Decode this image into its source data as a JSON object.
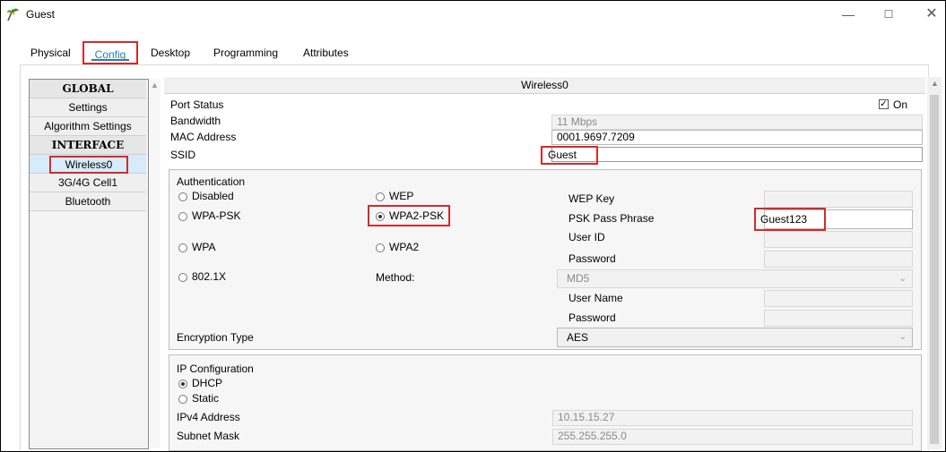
{
  "window": {
    "title": "Guest",
    "minimize": "—",
    "maximize": "☐",
    "close": "✕"
  },
  "tabs": [
    {
      "label": "Physical"
    },
    {
      "label": "Config"
    },
    {
      "label": "Desktop"
    },
    {
      "label": "Programming"
    },
    {
      "label": "Attributes"
    }
  ],
  "nav": {
    "global_header": "GLOBAL",
    "settings": "Settings",
    "algorithm_settings": "Algorithm Settings",
    "interface_header": "INTERFACE",
    "wireless0": "Wireless0",
    "cell": "3G/4G Cell1",
    "bluetooth": "Bluetooth"
  },
  "panel": {
    "title": "Wireless0",
    "port_status_label": "Port Status",
    "port_status_on": "On",
    "bandwidth_label": "Bandwidth",
    "bandwidth_value": "11 Mbps",
    "mac_label": "MAC Address",
    "mac_value": "0001.9697.7209",
    "ssid_label": "SSID",
    "ssid_value": "Guest"
  },
  "auth": {
    "title": "Authentication",
    "disabled": "Disabled",
    "wep": "WEP",
    "wpa_psk": "WPA-PSK",
    "wpa2_psk": "WPA2-PSK",
    "wpa": "WPA",
    "wpa2": "WPA2",
    "dot1x": "802.1X",
    "method_label": "Method:",
    "wep_key_label": "WEP Key",
    "psk_label": "PSK Pass Phrase",
    "psk_value": "Guest123",
    "user_id_label": "User ID",
    "password_label": "Password",
    "method_value": "MD5",
    "user_name_label": "User Name",
    "password2_label": "Password",
    "encryption_label": "Encryption Type",
    "encryption_value": "AES"
  },
  "ip": {
    "title": "IP Configuration",
    "dhcp": "DHCP",
    "static": "Static",
    "ipv4_label": "IPv4 Address",
    "ipv4_value": "10.15.15.27",
    "subnet_label": "Subnet Mask",
    "subnet_value": "255.255.255.0"
  },
  "colors": {
    "highlight": "#d12b2b",
    "accent": "#2a7ab8",
    "selected": "#d7ebfa"
  }
}
